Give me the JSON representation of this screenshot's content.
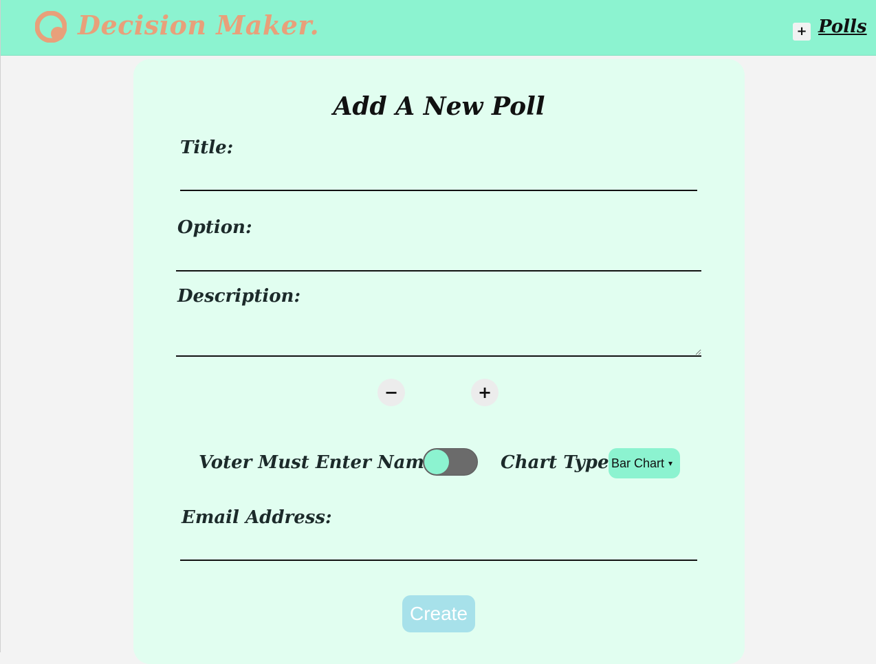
{
  "header": {
    "brand": "Decision Maker.",
    "nav_plus": "+",
    "nav_polls": "Polls",
    "brand_color": "#e8a07a",
    "bar_color": "#8cf3d0"
  },
  "form": {
    "title": "Add A New Poll",
    "title_label": "Title:",
    "option_label": "Option:",
    "description_label": "Description:",
    "remove_option": "−",
    "add_option": "+",
    "voter_name_label": "Voter Must Enter Name?",
    "chart_type_label": "Chart Type:",
    "chart_type_selected": "Bar Chart",
    "email_label": "Email Address:",
    "create_button": "Create",
    "title_value": "",
    "option_value": "",
    "description_value": "",
    "email_value": "",
    "voter_name_required": false
  }
}
